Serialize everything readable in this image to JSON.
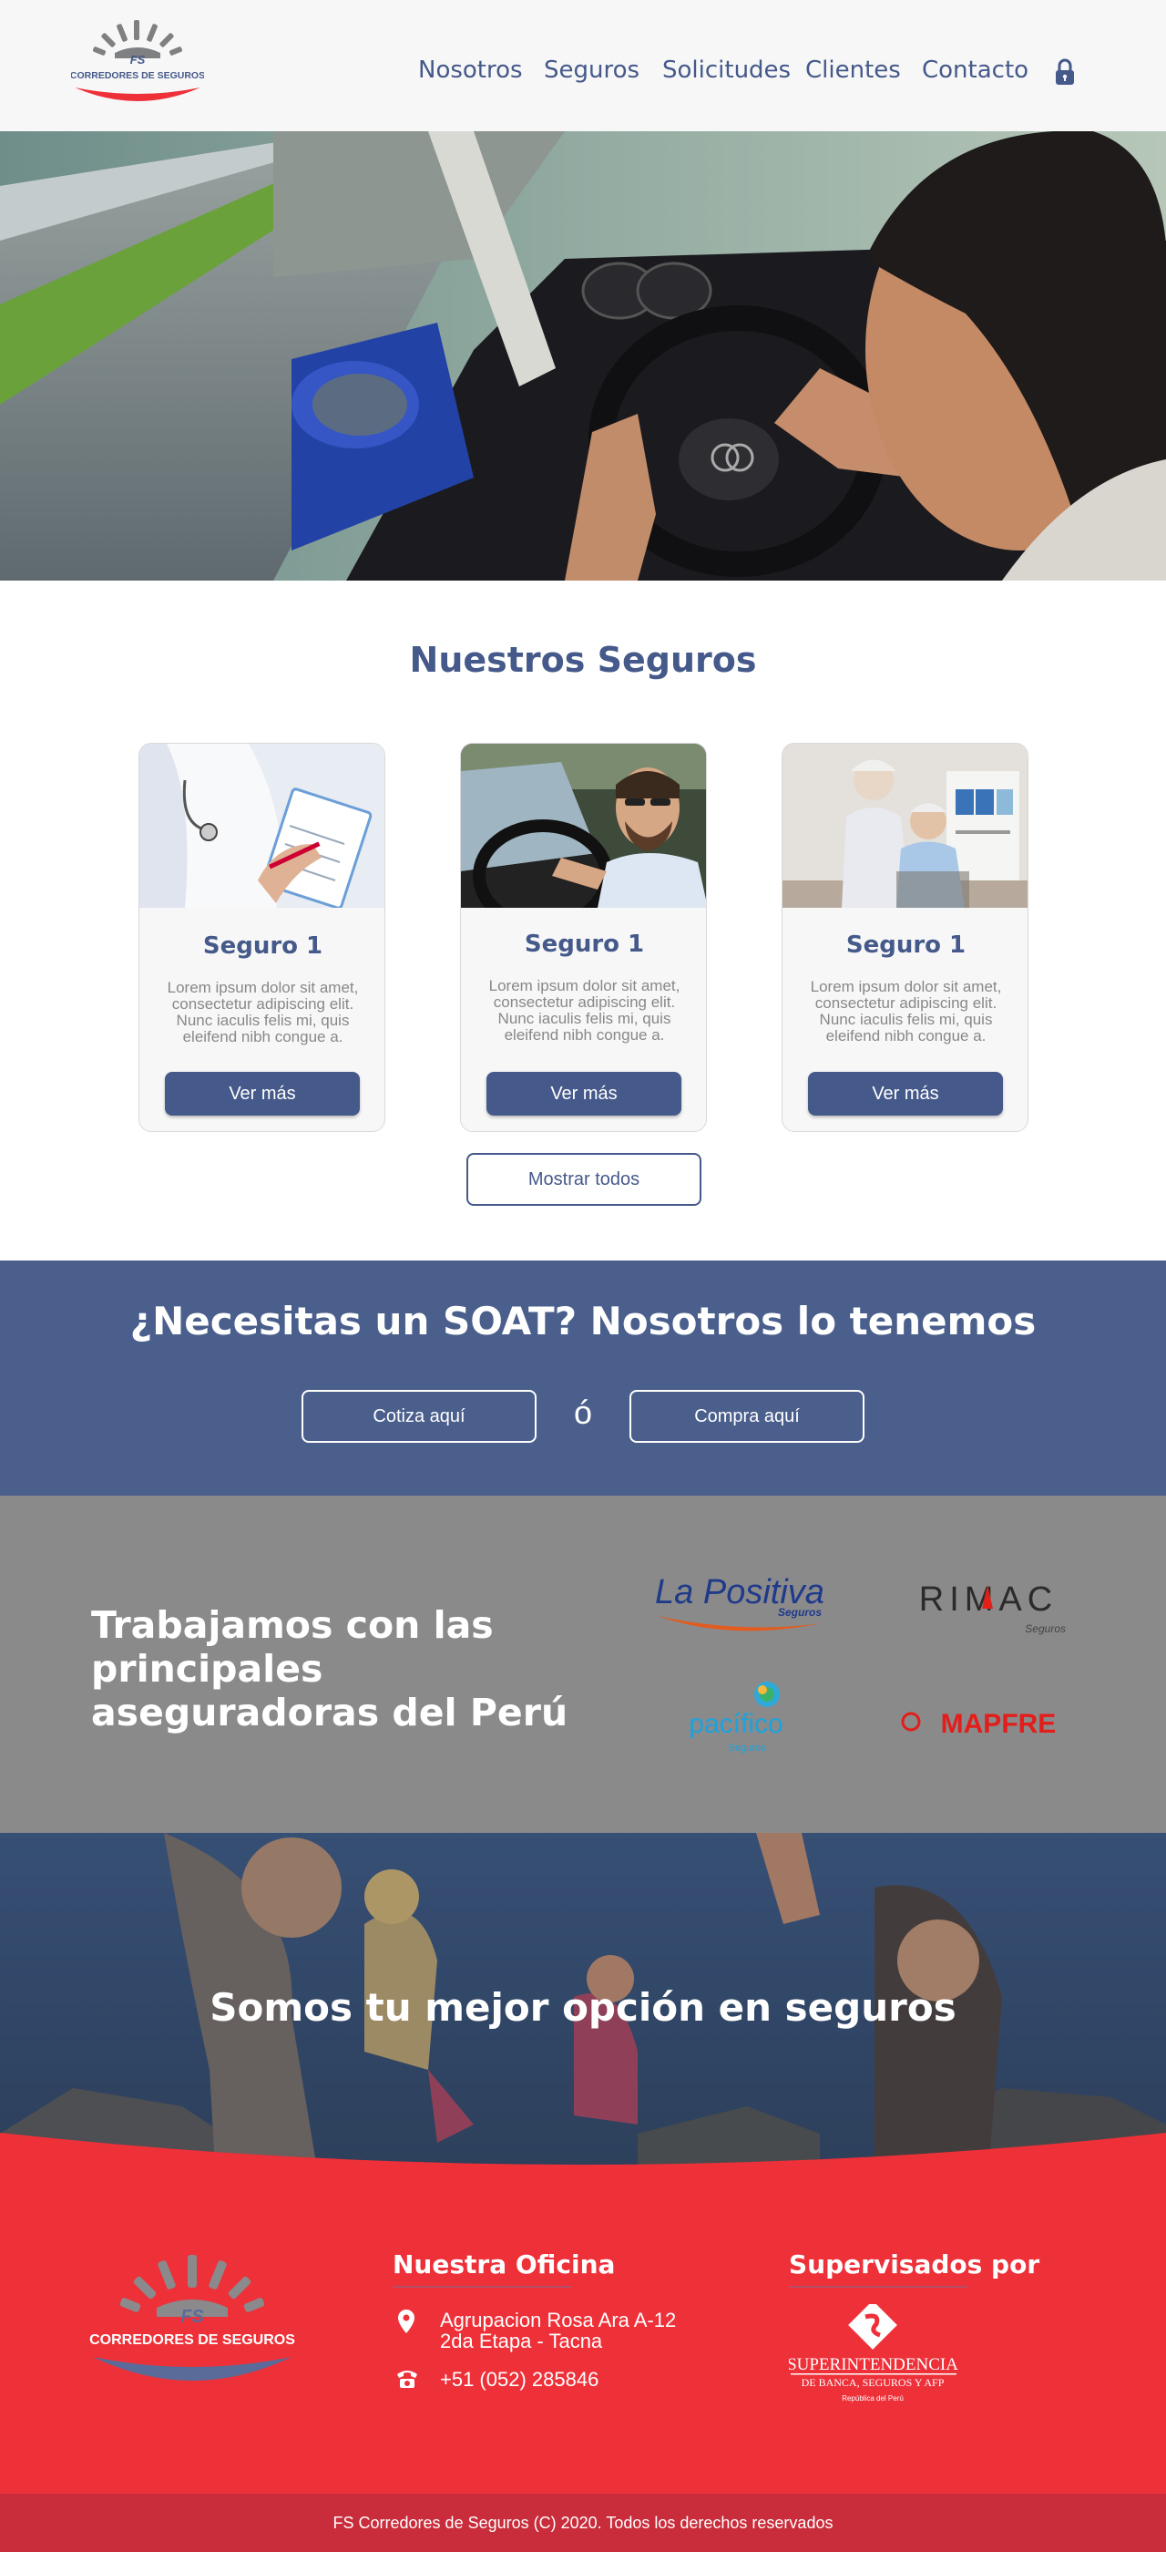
{
  "header": {
    "logo_text": "FS",
    "logo_subtitle": "CORREDORES DE SEGUROS",
    "nav": [
      {
        "label": "Nosotros"
      },
      {
        "label": "Seguros"
      },
      {
        "label": "Solicitudes"
      },
      {
        "label": "Clientes"
      },
      {
        "label": "Contacto"
      }
    ],
    "lock_icon": "lock-icon"
  },
  "hero": {
    "image": "man-driving-convertible-car"
  },
  "seguros": {
    "title": "Nuestros Seguros",
    "cards": [
      {
        "image": "doctor-with-clipboard",
        "title": "Seguro 1",
        "text": "Lorem ipsum dolor sit amet, consectetur adipiscing elit. Nunc iaculis felis mi, quis eleifend nibh congue a.",
        "button": "Ver más"
      },
      {
        "image": "smiling-man-driving",
        "title": "Seguro 1",
        "text": "Lorem ipsum dolor sit amet, consectetur adipiscing elit. Nunc iaculis felis mi, quis eleifend nibh congue a.",
        "button": "Ver más"
      },
      {
        "image": "elderly-couple",
        "title": "Seguro 1",
        "text": "Lorem ipsum dolor sit amet, consectetur adipiscing elit. Nunc iaculis felis mi, quis eleifend nibh congue a.",
        "button": "Ver más"
      }
    ],
    "show_all": "Mostrar todos"
  },
  "soat": {
    "title": "¿Necesitas un SOAT? Nosotros lo tenemos",
    "quote_button": "Cotiza aquí",
    "or_text": "ó",
    "buy_button": "Compra aquí"
  },
  "insurers": {
    "title": "Trabajamos con las principales aseguradoras del Perú",
    "logos": {
      "la_positiva": "La Positiva",
      "la_positiva_sub": "Seguros",
      "rimac": "RIMAC",
      "rimac_sub": "Seguros",
      "pacifico": "pacífico",
      "pacifico_sub": "Seguros",
      "mapfre": "MAPFRE"
    }
  },
  "family": {
    "title": "Somos tu mejor opción en seguros"
  },
  "footer": {
    "office_title": "Nuestra Oficina",
    "address_line1": "Agrupacion Rosa Ara A-12",
    "address_line2": "2da Etapa - Tacna",
    "phone": "+51 (052) 285846",
    "supervised_title": "Supervisados por",
    "sbs_name": "SUPERINTENDENCIA",
    "sbs_sub": "DE BANCA, SEGUROS Y AFP",
    "sbs_country": "República del Perú",
    "copyright": "FS Corredores de Seguros (C) 2020. Todos los derechos reservados"
  },
  "colors": {
    "brand_blue": "#45598a",
    "soat_blue": "#4a5f8c",
    "footer_red": "#ee3039",
    "copyright_red": "#c92c3a",
    "insurers_gray": "#8a8a8a"
  }
}
